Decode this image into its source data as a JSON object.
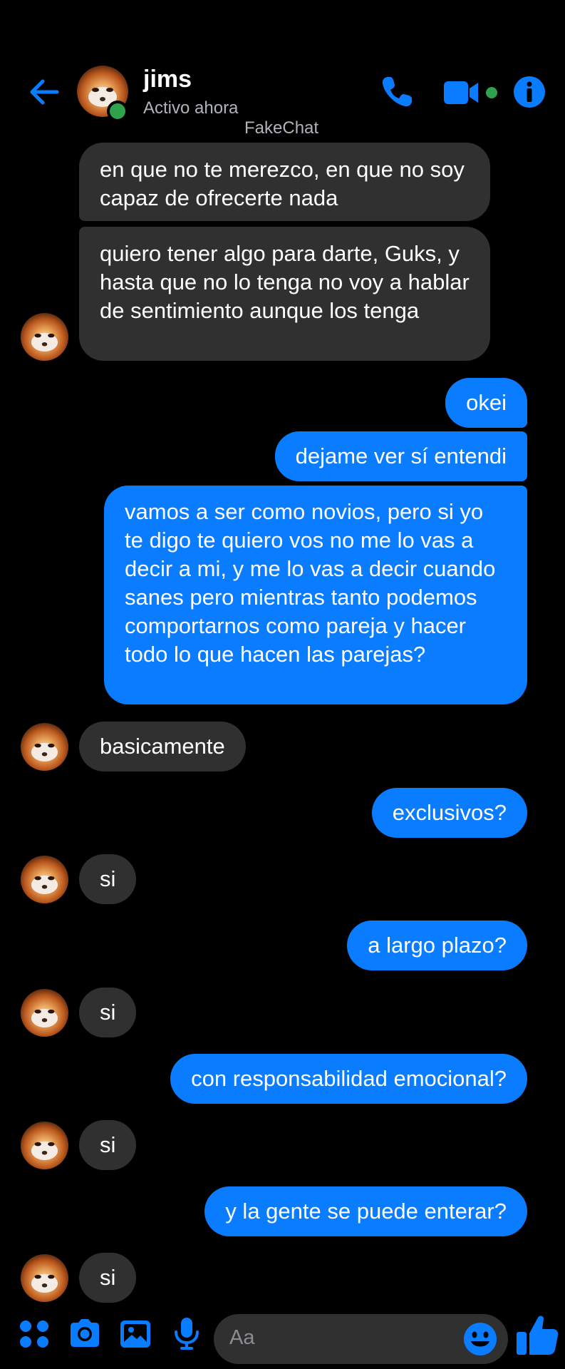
{
  "header": {
    "contact_name": "jims",
    "status": "Activo ahora",
    "watermark": "FakeChat"
  },
  "messages": [
    {
      "from": "them",
      "text": "en que no te merezco, en que no soy capaz de ofrecerte nada"
    },
    {
      "from": "them",
      "text": "quiero tener algo para darte, Guks, y hasta que no lo tenga no voy a hablar de sentimiento aunque los tenga"
    },
    {
      "from": "me",
      "text": "okei"
    },
    {
      "from": "me",
      "text": "dejame ver sí entendi"
    },
    {
      "from": "me",
      "text": "vamos a ser como novios, pero si yo te digo te quiero vos no me lo vas a decir a mi, y me lo vas a decir cuando sanes pero mientras tanto podemos comportarnos como pareja y hacer todo lo que hacen las parejas?"
    },
    {
      "from": "them",
      "text": "basicamente"
    },
    {
      "from": "me",
      "text": "exclusivos?"
    },
    {
      "from": "them",
      "text": "si"
    },
    {
      "from": "me",
      "text": "a largo plazo?"
    },
    {
      "from": "them",
      "text": "si"
    },
    {
      "from": "me",
      "text": "con responsabilidad emocional?"
    },
    {
      "from": "them",
      "text": "si"
    },
    {
      "from": "me",
      "text": "y la gente se puede enterar?"
    },
    {
      "from": "them",
      "text": "si"
    }
  ],
  "composer": {
    "placeholder": "Aa"
  },
  "icons": {
    "back": "arrow-left-icon",
    "call": "phone-icon",
    "video": "video-camera-icon",
    "info": "info-icon",
    "menu": "four-dots-icon",
    "camera": "camera-icon",
    "gallery": "image-icon",
    "mic": "microphone-icon",
    "emoji": "smiley-icon",
    "like": "thumbs-up-icon"
  },
  "colors": {
    "accent": "#0a7cff",
    "incoming_bubble": "#303030",
    "online": "#31a24c",
    "background": "#000000"
  }
}
